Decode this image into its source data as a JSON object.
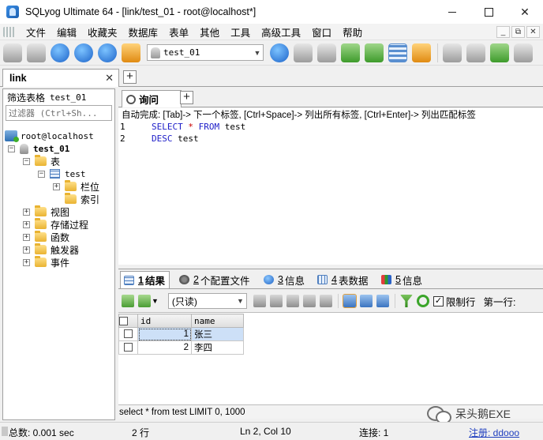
{
  "window": {
    "title": "SQLyog Ultimate 64 - [link/test_01 - root@localhost*]",
    "min_glyph": "",
    "max_glyph": "",
    "close_glyph": "✕"
  },
  "menu": {
    "items": [
      "文件",
      "编辑",
      "收藏夹",
      "数据库",
      "表单",
      "其他",
      "工具",
      "高级工具",
      "窗口",
      "帮助"
    ],
    "mdi_buttons": [
      "_",
      "⧉",
      "✕"
    ]
  },
  "toolbar": {
    "database_select": "test_01",
    "select_arrow": "▼"
  },
  "connection_tab": {
    "label": "link",
    "close": "✕",
    "add": "+"
  },
  "object_browser": {
    "filter_label": "筛选表格",
    "filter_db": "test_01",
    "filter_placeholder": "过滤器 (Ctrl+Sh...",
    "tree": {
      "server": "root@localhost",
      "database": "test_01",
      "tables_folder": "表",
      "table": "test",
      "columns_folder": "栏位",
      "indexes_folder": "索引",
      "views": "视图",
      "procedures": "存储过程",
      "functions": "函数",
      "triggers": "触发器",
      "events": "事件"
    },
    "expand_plus": "+",
    "expand_minus": "−"
  },
  "query": {
    "tab_label": "询问",
    "add": "+",
    "hint": "自动完成: [Tab]-> 下一个标签, [Ctrl+Space]-> 列出所有标签, [Ctrl+Enter]-> 列出匹配标签",
    "lines": [
      {
        "num": "1",
        "kw1": "SELECT",
        "op": "*",
        "kw2": "FROM",
        "rest": "test"
      },
      {
        "num": "2",
        "kw1": "DESC",
        "rest": "test"
      }
    ]
  },
  "result_tabs": [
    {
      "num": "1",
      "label": "结果"
    },
    {
      "num": "2",
      "label": "个配置文件"
    },
    {
      "num": "3",
      "label": "信息"
    },
    {
      "num": "4",
      "label": "表数据"
    },
    {
      "num": "5",
      "label": "信息"
    }
  ],
  "result_toolbar": {
    "mode": "(只读)",
    "arrow": "▼",
    "limit_checked": "✓",
    "limit_label": "限制行",
    "first_row_label": "第一行:"
  },
  "grid": {
    "columns": [
      "id",
      "name"
    ],
    "rows": [
      {
        "id": "1",
        "name": "张三"
      },
      {
        "id": "2",
        "name": "李四"
      }
    ]
  },
  "sql_bar": "select * from test LIMIT 0, 1000",
  "status": {
    "time": "总数: 0.001 sec",
    "rows": "2 行",
    "position": "Ln 2, Col 10",
    "connection": "连接: 1",
    "register": "注册: ddooo"
  },
  "watermark": "呆头鹅EXE"
}
